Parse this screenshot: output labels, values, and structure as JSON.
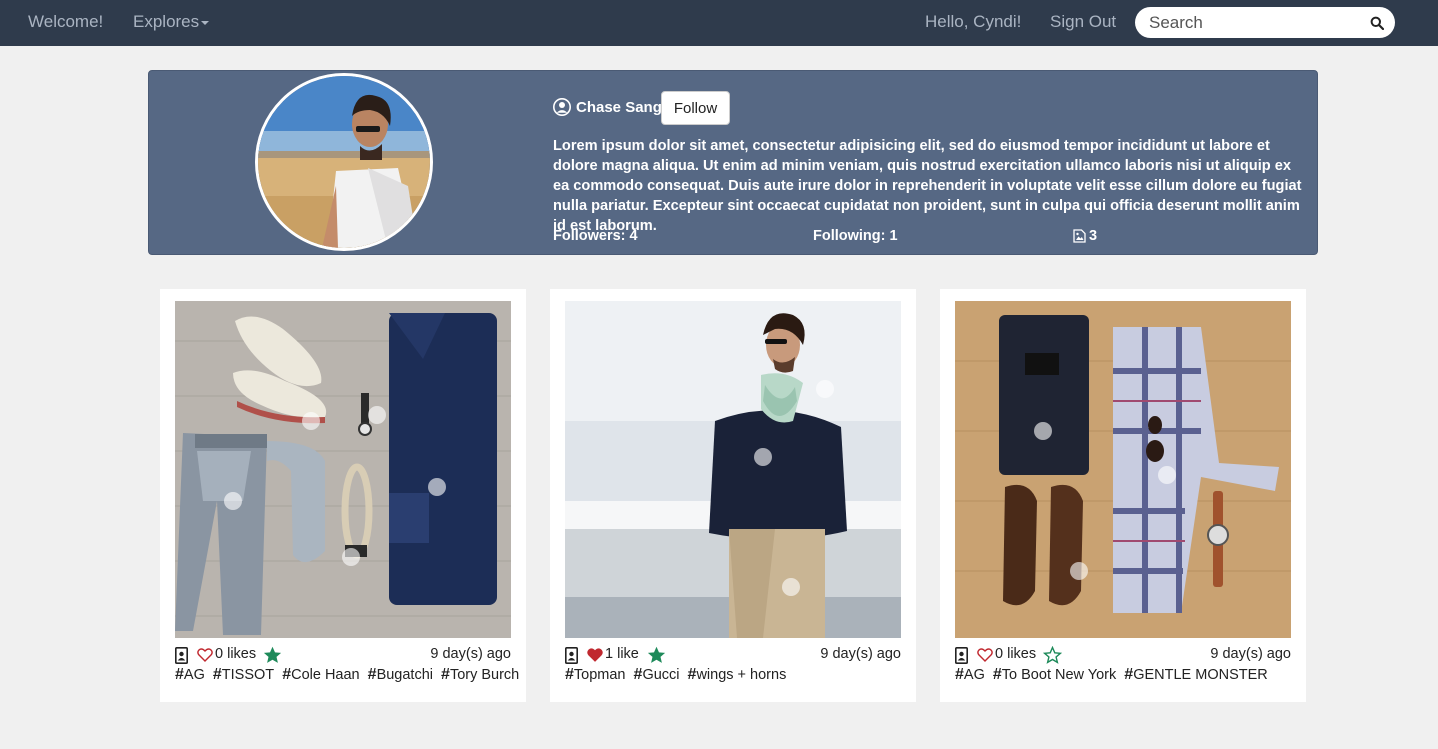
{
  "nav": {
    "welcome": "Welcome!",
    "explores": "Explores",
    "greeting": "Hello, Cyndi!",
    "sign_out": "Sign Out",
    "search_placeholder": "Search"
  },
  "profile": {
    "username": "Chase Sang",
    "follow_label": "Follow",
    "bio": "Lorem ipsum dolor sit amet, consectetur adipisicing elit, sed do eiusmod tempor incididunt ut labore et dolore magna aliqua. Ut enim ad minim veniam, quis nostrud exercitation ullamco laboris nisi ut aliquip ex ea commodo consequat. Duis aute irure dolor in reprehenderit in voluptate velit esse cillum dolore eu fugiat nulla pariatur. Excepteur sint occaecat cupidatat non proident, sunt in culpa qui officia deserunt mollit anim id est laborum.",
    "followers": "Followers: 4",
    "following": "Following: 1",
    "posts_count": "3"
  },
  "posts": [
    {
      "likes": "0 likes",
      "liked": false,
      "starred": true,
      "date": "9 day(s) ago",
      "tags": [
        "AG",
        "TISSOT",
        "Cole Haan",
        "Bugatchi",
        "Tory Burch"
      ]
    },
    {
      "likes": "1 like",
      "liked": true,
      "starred": true,
      "date": "9 day(s) ago",
      "tags": [
        "Topman",
        "Gucci",
        "wings + horns"
      ]
    },
    {
      "likes": "0 likes",
      "liked": false,
      "starred": false,
      "date": "9 day(s) ago",
      "tags": [
        "AG",
        "To Boot New York",
        "GENTLE MONSTER"
      ]
    }
  ],
  "colors": {
    "navbar": "#2f3b4c",
    "profile_bg": "#566884",
    "heart_liked": "#c0282f",
    "star": "#1e8a5a"
  }
}
